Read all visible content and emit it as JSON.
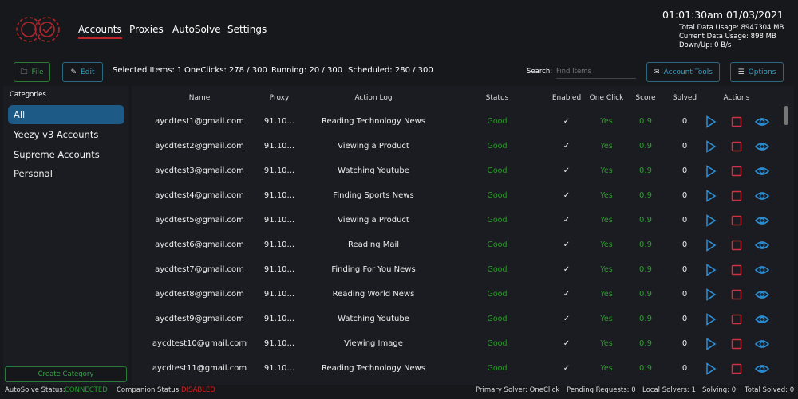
{
  "header": {
    "tabs": [
      {
        "label": "Accounts",
        "active": true
      },
      {
        "label": "Proxies"
      },
      {
        "label": "AutoSolve"
      },
      {
        "label": "Settings"
      }
    ],
    "datetime": "01:01:30am 01/03/2021",
    "total_data": "Total Data Usage:  8947304 MB",
    "current_data": "Current Data Usage: 898 MB",
    "down_up": "Down/Up: 0 B/s"
  },
  "toolbar": {
    "file_label": "File",
    "edit_label": "Edit",
    "selected": "Selected Items: 1",
    "oneclicks": "OneClicks: 278 / 300",
    "running": "Running: 20 / 300",
    "scheduled": "Scheduled: 280 / 300",
    "search_label": "Search:",
    "search_placeholder": "Find Items",
    "account_tools_label": "Account Tools",
    "options_label": "Options"
  },
  "sidebar": {
    "title": "Categories",
    "items": [
      "All",
      "Yeezy v3 Accounts",
      "Supreme Accounts",
      "Personal"
    ],
    "create_label": "Create Category"
  },
  "table": {
    "headers": [
      "Name",
      "Proxy",
      "Action Log",
      "Status",
      "Enabled",
      "One Click",
      "Score",
      "Solved",
      "Actions"
    ],
    "rows": [
      [
        "aycdtest1@gmail.com",
        "91.10...",
        "Reading Technology News",
        "Good",
        "✓",
        "Yes",
        "0.9",
        "0"
      ],
      [
        "aycdtest2@gmail.com",
        "91.10...",
        "Viewing a Product",
        "Good",
        "✓",
        "Yes",
        "0.9",
        "0"
      ],
      [
        "aycdtest3@gmail.com",
        "91.10...",
        "Watching Youtube",
        "Good",
        "✓",
        "Yes",
        "0.9",
        "0"
      ],
      [
        "aycdtest4@gmail.com",
        "91.10...",
        "Finding Sports News",
        "Good",
        "✓",
        "Yes",
        "0.9",
        "0"
      ],
      [
        "aycdtest5@gmail.com",
        "91.10...",
        "Viewing a Product",
        "Good",
        "✓",
        "Yes",
        "0.9",
        "0"
      ],
      [
        "aycdtest6@gmail.com",
        "91.10...",
        "Reading Mail",
        "Good",
        "✓",
        "Yes",
        "0.9",
        "0"
      ],
      [
        "aycdtest7@gmail.com",
        "91.10...",
        "Finding For You News",
        "Good",
        "✓",
        "Yes",
        "0.9",
        "0"
      ],
      [
        "aycdtest8@gmail.com",
        "91.10...",
        "Reading World News",
        "Good",
        "✓",
        "Yes",
        "0.9",
        "0"
      ],
      [
        "aycdtest9@gmail.com",
        "91.10...",
        "Watching Youtube",
        "Good",
        "✓",
        "Yes",
        "0.9",
        "0"
      ],
      [
        "aycdtest10@gmail.com",
        "91.10...",
        "Viewing Image",
        "Good",
        "✓",
        "Yes",
        "0.9",
        "0"
      ],
      [
        "aycdtest11@gmail.com",
        "91.10...",
        "Reading Technology News",
        "Good",
        "✓",
        "Yes",
        "0.9",
        "0"
      ]
    ]
  },
  "footer": {
    "autosolve_label": "AutoSolve Status:",
    "autosolve_value": "CONNECTED",
    "companion_label": "Companion Status:",
    "companion_value": "DISABLED",
    "primary": "Primary Solver: OneClick",
    "pending": "Pending Requests: 0",
    "local": "Local Solvers: 1",
    "solving": "Solving: 0",
    "total": "Total Solved: 0"
  },
  "colors": {
    "accent_red": "#c0262c",
    "selected_blue": "#1d5a85",
    "green": "#2f9a2f",
    "play_blue": "#2d8fd6"
  }
}
